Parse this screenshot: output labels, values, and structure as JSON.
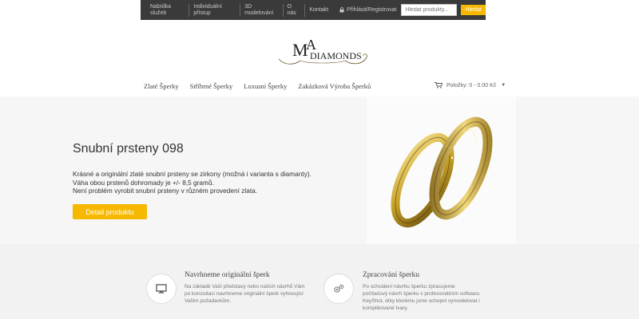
{
  "topbar": {
    "nav": [
      "Nabídka služeb",
      "Individuální přístup",
      "3D modelování",
      "O nás",
      "Kontakt"
    ],
    "login_label": "Přihlásit/Registrovat",
    "search_placeholder": "Hledat produkty...",
    "search_button": "Hledat"
  },
  "logo": {
    "letters_top": "MA",
    "letters_bottom": "DIAMONDS"
  },
  "mainnav": [
    "Zlaté Šperky",
    "Stříbrné Šperky",
    "Luxusní Šperky",
    "Zakázková Výroba Šperků"
  ],
  "cart": {
    "label": "Položky: 0 - 0.00 Kč"
  },
  "hero": {
    "title": "Snubní prsteny 098",
    "desc_lines": [
      "Krásné a originální zlaté snubní prsteny se zirkony (možná i varianta s diamanty).",
      "Váha obou prstenů dohromady je +/- 8,5 gramů.",
      "Není problém vyrobit snubní prsteny v různém provedení zlata."
    ],
    "button": "Detail produktu"
  },
  "features": [
    {
      "icon": "monitor-icon",
      "title": "Navrhneme originální šperk",
      "text_lines": [
        "Na základě Vaší představy nebo našich návrhů Vám",
        "po konzultaci navrhneme originální šperk vyhovující",
        "Vašim požadavkům."
      ]
    },
    {
      "icon": "gears-icon",
      "title": "Zpracování šperku",
      "text_lines": [
        "Po schválení návrhu šperku zpracujeme",
        "počítačový návrh šperku v profesionálním softwaru",
        "KeyShot, díky kterému jsme schopni vymodelovat i",
        "komplikované tvary."
      ]
    }
  ],
  "colors": {
    "accent": "#f6b800",
    "topbar": "#3a3a3a",
    "hero_bg": "#f6f6f6",
    "gold": "#c9a227"
  }
}
